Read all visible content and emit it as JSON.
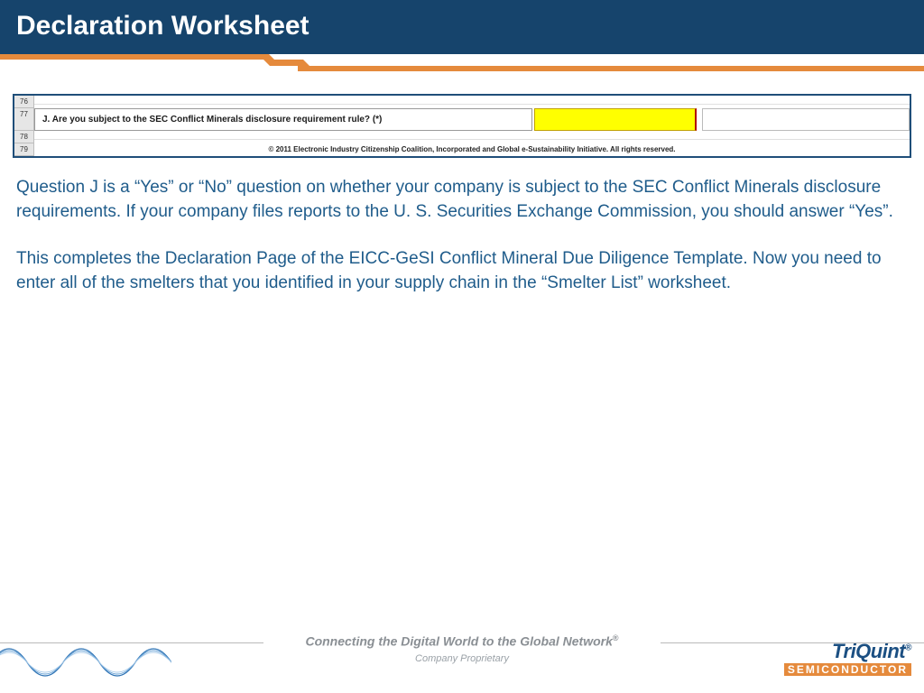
{
  "header": {
    "title": "Declaration Worksheet"
  },
  "sheet": {
    "rows": [
      "76",
      "77",
      "78",
      "79"
    ],
    "question_j": "J. Are you subject to the SEC Conflict Minerals disclosure requirement rule? (*)",
    "copyright": "© 2011 Electronic Industry Citizenship Coalition, Incorporated and Global e-Sustainability Initiative. All rights reserved."
  },
  "body": {
    "p1": "Question J is a “Yes” or “No” question on whether your company is subject to the SEC Conflict Minerals disclosure requirements.  If your company files reports to the U. S. Securities Exchange Commission, you should answer “Yes”.",
    "p2": "This completes the Declaration Page of the EICC-GeSI Conflict Mineral Due Diligence Template.  Now you need to enter all of the smelters that you identified in your supply chain in the “Smelter List” worksheet."
  },
  "footer": {
    "tagline": "Connecting the Digital World to the Global Network",
    "reg": "®",
    "subtag": "Company Proprietary",
    "logo_top": "TriQuint",
    "logo_reg": "®",
    "logo_bottom": "SEMICONDUCTOR"
  }
}
